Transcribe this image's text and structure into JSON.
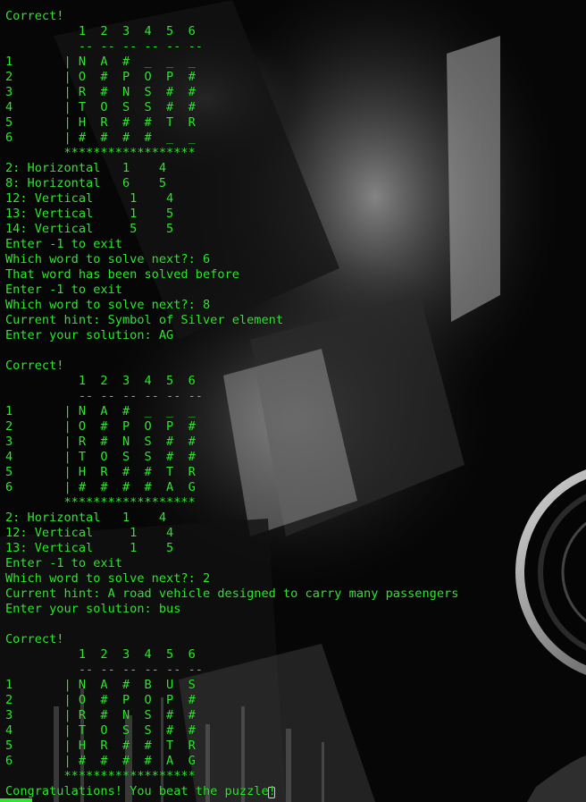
{
  "colors": {
    "terminal_text": "#2ee62e",
    "background": "#060606"
  },
  "terminal": {
    "lines": [
      "Correct!",
      "          1  2  3  4  5  6",
      "          -- -- -- -- -- --",
      "1       | N  A  #  _  _  _",
      "2       | O  #  P  O  P  #",
      "3       | R  #  N  S  #  #",
      "4       | T  O  S  S  #  #",
      "5       | H  R  #  #  T  R",
      "6       | #  #  #  #  _  _",
      "        ******************",
      "2: Horizontal   1    4",
      "8: Horizontal   6    5",
      "12: Vertical     1    4",
      "13: Vertical     1    5",
      "14: Vertical     5    5",
      "Enter -1 to exit",
      "Which word to solve next?: 6",
      "That word has been solved before",
      "Enter -1 to exit",
      "Which word to solve next?: 8",
      "Current hint: Symbol of Silver element",
      "Enter your solution: AG",
      "",
      "Correct!",
      "          1  2  3  4  5  6",
      "          -- -- -- -- -- --",
      "1       | N  A  #  _  _  _",
      "2       | O  #  P  O  P  #",
      "3       | R  #  N  S  #  #",
      "4       | T  O  S  S  #  #",
      "5       | H  R  #  #  T  R",
      "6       | #  #  #  #  A  G",
      "        ******************",
      "2: Horizontal   1    4",
      "12: Vertical     1    4",
      "13: Vertical     1    5",
      "Enter -1 to exit",
      "Which word to solve next?: 2",
      "Current hint: A road vehicle designed to carry many passengers",
      "Enter your solution: bus",
      "",
      "Correct!",
      "          1  2  3  4  5  6",
      "          -- -- -- -- -- --",
      "1       | N  A  #  B  U  S",
      "2       | O  #  P  O  P  #",
      "3       | R  #  N  S  #  #",
      "4       | T  O  S  S  #  #",
      "5       | H  R  #  #  T  R",
      "6       | #  #  #  #  A  G",
      "        ******************",
      "Congratulations! You beat the puzzle!"
    ]
  }
}
